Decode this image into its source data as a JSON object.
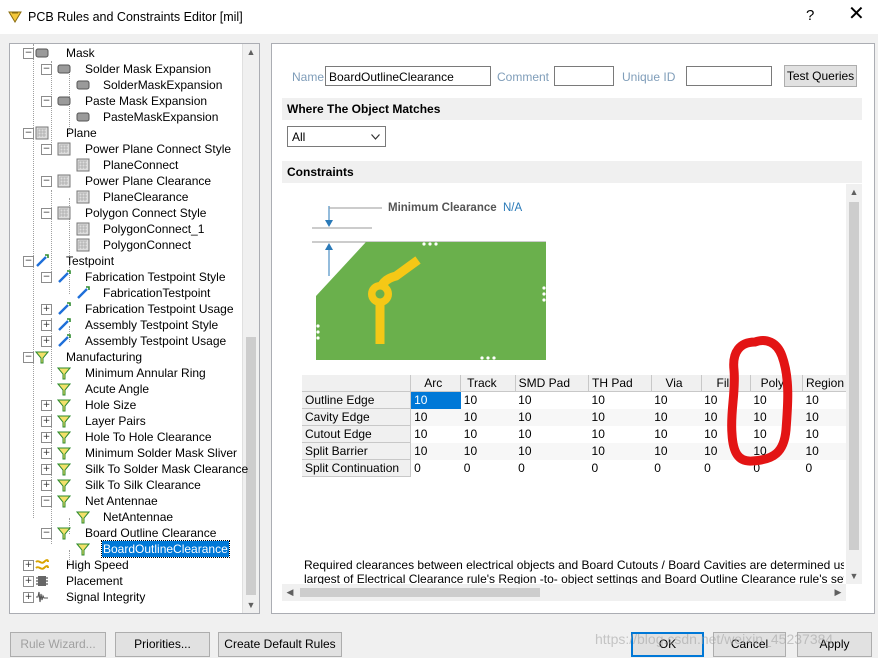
{
  "window": {
    "title": "PCB Rules and Constraints Editor [mil]",
    "help_label": "?",
    "close_label": "✕"
  },
  "tree": {
    "items": [
      {
        "label": "Mask",
        "level": 1,
        "exp": "−",
        "icon": "mask-icon"
      },
      {
        "label": "Solder Mask Expansion",
        "level": 2,
        "exp": "−",
        "icon": "mask-icon"
      },
      {
        "label": "SolderMaskExpansion",
        "level": 3,
        "icon": "mask-icon"
      },
      {
        "label": "Paste Mask Expansion",
        "level": 2,
        "exp": "−",
        "icon": "mask-icon"
      },
      {
        "label": "PasteMaskExpansion",
        "level": 3,
        "icon": "mask-icon"
      },
      {
        "label": "Plane",
        "level": 1,
        "exp": "−",
        "icon": "plane-icon"
      },
      {
        "label": "Power Plane Connect Style",
        "level": 2,
        "exp": "−",
        "icon": "plane-icon"
      },
      {
        "label": "PlaneConnect",
        "level": 3,
        "icon": "plane-icon"
      },
      {
        "label": "Power Plane Clearance",
        "level": 2,
        "exp": "−",
        "icon": "plane-icon"
      },
      {
        "label": "PlaneClearance",
        "level": 3,
        "icon": "plane-icon"
      },
      {
        "label": "Polygon Connect Style",
        "level": 2,
        "exp": "−",
        "icon": "plane-icon"
      },
      {
        "label": "PolygonConnect_1",
        "level": 3,
        "icon": "plane-icon"
      },
      {
        "label": "PolygonConnect",
        "level": 3,
        "icon": "plane-icon"
      },
      {
        "label": "Testpoint",
        "level": 1,
        "exp": "−",
        "icon": "testpoint-icon"
      },
      {
        "label": "Fabrication Testpoint Style",
        "level": 2,
        "exp": "−",
        "icon": "testpoint-icon"
      },
      {
        "label": "FabricationTestpoint",
        "level": 3,
        "icon": "testpoint-icon"
      },
      {
        "label": "Fabrication Testpoint Usage",
        "level": 2,
        "exp": "+",
        "icon": "testpoint-icon"
      },
      {
        "label": "Assembly Testpoint Style",
        "level": 2,
        "exp": "+",
        "icon": "testpoint-icon"
      },
      {
        "label": "Assembly Testpoint Usage",
        "level": 2,
        "exp": "+",
        "icon": "testpoint-icon"
      },
      {
        "label": "Manufacturing",
        "level": 1,
        "exp": "−",
        "icon": "funnel-icon"
      },
      {
        "label": "Minimum Annular Ring",
        "level": 2,
        "icon": "funnel-icon"
      },
      {
        "label": "Acute Angle",
        "level": 2,
        "icon": "funnel-icon"
      },
      {
        "label": "Hole Size",
        "level": 2,
        "exp": "+",
        "icon": "funnel-icon"
      },
      {
        "label": "Layer Pairs",
        "level": 2,
        "exp": "+",
        "icon": "funnel-icon"
      },
      {
        "label": "Hole To Hole Clearance",
        "level": 2,
        "exp": "+",
        "icon": "funnel-icon"
      },
      {
        "label": "Minimum Solder Mask Sliver",
        "level": 2,
        "exp": "+",
        "icon": "funnel-icon"
      },
      {
        "label": "Silk To Solder Mask Clearance",
        "level": 2,
        "exp": "+",
        "icon": "funnel-icon"
      },
      {
        "label": "Silk To Silk Clearance",
        "level": 2,
        "exp": "+",
        "icon": "funnel-icon"
      },
      {
        "label": "Net Antennae",
        "level": 2,
        "exp": "−",
        "icon": "funnel-icon"
      },
      {
        "label": "NetAntennae",
        "level": 3,
        "icon": "funnel-icon"
      },
      {
        "label": "Board Outline Clearance",
        "level": 2,
        "exp": "−",
        "icon": "funnel-icon"
      },
      {
        "label": "BoardOutlineClearance",
        "level": 3,
        "icon": "funnel-icon",
        "selected": true
      },
      {
        "label": "High Speed",
        "level": 1,
        "exp": "+",
        "icon": "highspeed-icon"
      },
      {
        "label": "Placement",
        "level": 1,
        "exp": "+",
        "icon": "placement-icon"
      },
      {
        "label": "Signal Integrity",
        "level": 1,
        "exp": "+",
        "icon": "signal-icon"
      }
    ]
  },
  "rule": {
    "name_label": "Name",
    "name_value": "BoardOutlineClearance",
    "comment_label": "Comment",
    "comment_value": "",
    "uid_label": "Unique ID",
    "uid_value": "",
    "test_queries_label": "Test Queries"
  },
  "where_section": {
    "title": "Where The Object Matches",
    "selected": "All"
  },
  "constraints": {
    "title": "Constraints",
    "min_clearance_label": "Minimum Clearance",
    "min_clearance_value": "N/A",
    "columns": [
      "Arc",
      "Track",
      "SMD Pad",
      "TH Pad",
      "Via",
      "Fill",
      "Poly",
      "Region"
    ],
    "rows": [
      {
        "name": "Outline Edge",
        "values": [
          "10",
          "10",
          "10",
          "10",
          "10",
          "10",
          "10",
          "10"
        ]
      },
      {
        "name": "Cavity Edge",
        "values": [
          "10",
          "10",
          "10",
          "10",
          "10",
          "10",
          "10",
          "10"
        ]
      },
      {
        "name": "Cutout Edge",
        "values": [
          "10",
          "10",
          "10",
          "10",
          "10",
          "10",
          "10",
          "10"
        ]
      },
      {
        "name": "Split Barrier",
        "values": [
          "10",
          "10",
          "10",
          "10",
          "10",
          "10",
          "10",
          "10"
        ]
      },
      {
        "name": "Split Continuation",
        "values": [
          "0",
          "0",
          "0",
          "0",
          "0",
          "0",
          "0",
          "0"
        ]
      }
    ],
    "description_line1": "Required clearances between electrical objects and Board Cutouts / Board Cavities are determined using t",
    "description_line2": "largest of Electrical Clearance rule's Region -to- object settings and Board Outline Clearance rule's setting"
  },
  "buttons": {
    "rule_wizard": "Rule Wizard...",
    "priorities": "Priorities...",
    "create_default": "Create Default Rules",
    "ok": "OK",
    "cancel": "Cancel",
    "apply": "Apply"
  },
  "watermark": "https://blog.csdn.net/weixin_45237384",
  "colors": {
    "board_green": "#6ab04c",
    "trace_yellow": "#f5c816",
    "selection_blue": "#0078d7",
    "annotation_red": "#e31414"
  }
}
